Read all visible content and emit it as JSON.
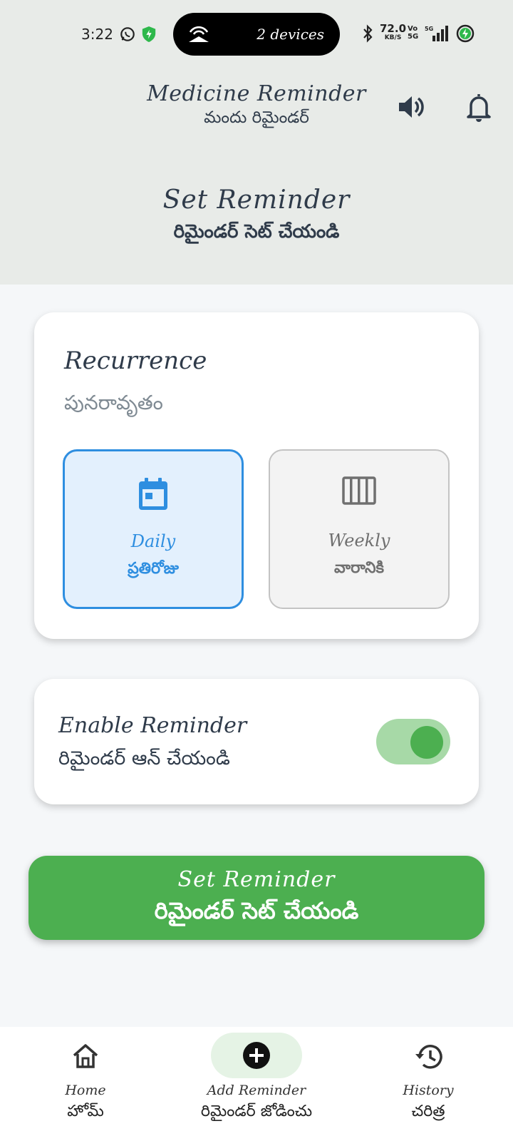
{
  "status_bar": {
    "time": "3:22",
    "pill_text": "2 devices",
    "net_speed": "72.0",
    "net_speed_unit": "KB/S",
    "vo_top": "Vo",
    "vo_bottom": "5G",
    "icons": [
      "whatsapp-icon",
      "shield-icon",
      "hotspot-icon",
      "bluetooth-icon",
      "signal-icon",
      "battery-charging-icon"
    ]
  },
  "header": {
    "title": "Medicine Reminder",
    "subtitle": "మందు రిమైండర్",
    "page_title": "Set Reminder",
    "page_subtitle": "రిమైండర్ సెట్ చేయండి",
    "icons": [
      "speaker-icon",
      "bell-icon"
    ]
  },
  "recurrence": {
    "title": "Recurrence",
    "subtitle": "పునరావృతం",
    "options": [
      {
        "label": "Daily",
        "sub": "ప్రతిరోజు",
        "icon": "calendar-icon",
        "selected": true
      },
      {
        "label": "Weekly",
        "sub": "వారానికి",
        "icon": "week-columns-icon",
        "selected": false
      }
    ]
  },
  "enable": {
    "title": "Enable Reminder",
    "subtitle": "రిమైండర్ ఆన్ చేయండి",
    "enabled": true
  },
  "set_button": {
    "label": "Set Reminder",
    "sub": "రిమైండర్ సెట్ చేయండి"
  },
  "nav": {
    "items": [
      {
        "label": "Home",
        "sub": "హోమ్",
        "icon": "home-icon"
      },
      {
        "label": "Add Reminder",
        "sub": "రిమైండర్ జోడించు",
        "icon": "add-circle-icon",
        "active": true
      },
      {
        "label": "History",
        "sub": "చరిత్ర",
        "icon": "history-icon"
      }
    ]
  },
  "colors": {
    "header_bg": "#e8ebe8",
    "accent_blue": "#2e8ee0",
    "accent_green": "#4caf50",
    "text_dark": "#2f3b4a"
  }
}
